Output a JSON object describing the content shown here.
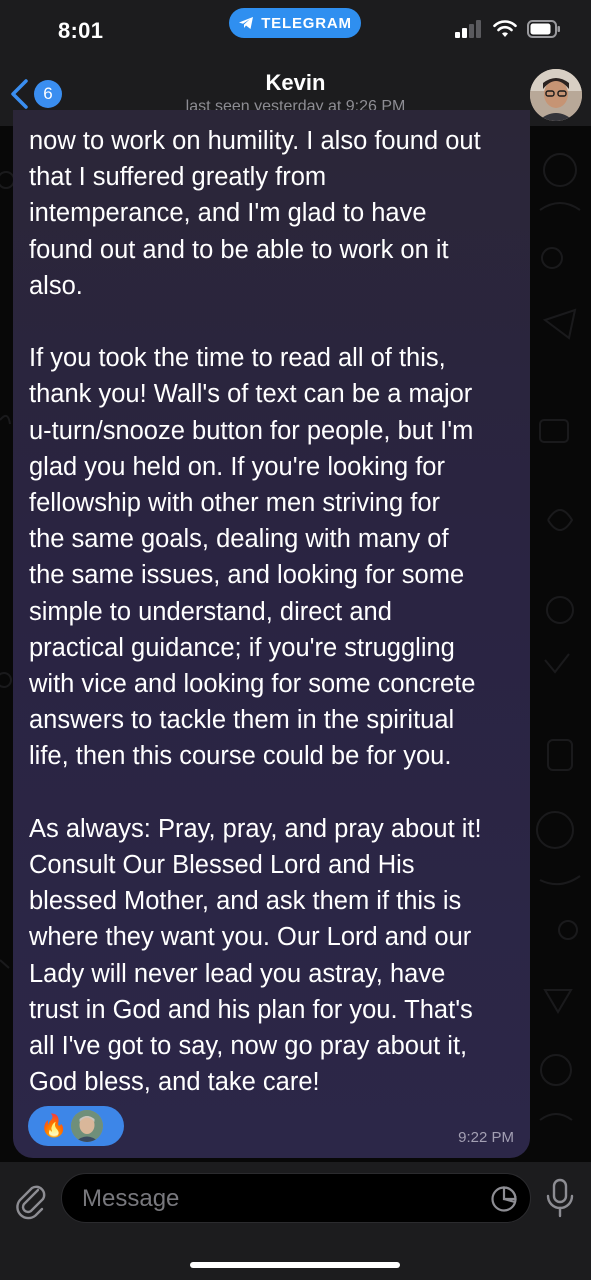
{
  "status_bar": {
    "time": "8:01",
    "app_pill": "TELEGRAM",
    "icons": [
      "signal-icon",
      "wifi-icon",
      "battery-icon"
    ]
  },
  "header": {
    "back_badge": "6",
    "name": "Kevin",
    "status": "last seen yesterday at 9:26 PM"
  },
  "message": {
    "text": "now to work on humility. I also found out\nthat I suffered greatly from\nintemperance, and I'm glad to have\nfound out and to be able to work on it\nalso.\n\nIf you took the time to read all of this,\nthank you! Wall's of text can be a major\nu-turn/snooze button for people, but I'm\nglad you held on. If you're looking for\nfellowship with other men striving for\nthe same goals, dealing with many of\nthe same issues, and looking for some\nsimple to understand, direct and\npractical guidance; if you're struggling\nwith vice and looking for some concrete\nanswers to tackle them in the spiritual\nlife, then this course could be for you.\n\nAs always: Pray, pray, and pray about it!\nConsult Our Blessed Lord and His\nblessed Mother, and ask them if this is\nwhere they want you. Our Lord and our\nLady will never lead you astray, have\ntrust in God and his plan for you. That's\nall I've got to say, now go pray about it,\nGod bless, and take care!",
    "reaction_emoji": "🔥",
    "time": "9:22 PM"
  },
  "input": {
    "placeholder": "Message"
  },
  "colors": {
    "accent": "#3a8ef0",
    "bubble": "#2a2442",
    "header_bg": "#1c1c1e",
    "secondary_text": "#8d8d93"
  }
}
